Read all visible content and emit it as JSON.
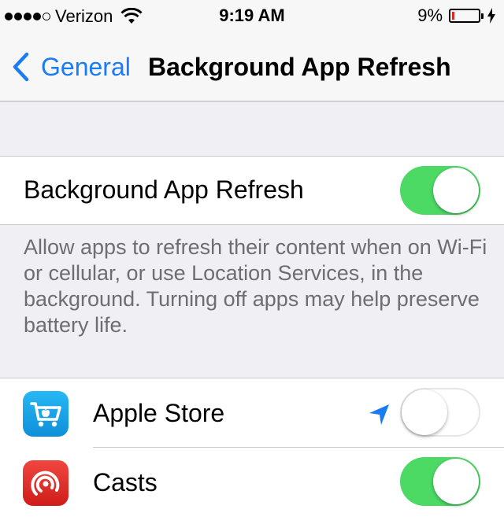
{
  "status_bar": {
    "carrier": "Verizon",
    "time": "9:19 AM",
    "battery_percent": "9%",
    "battery_level": 0.09,
    "signal_bars_filled": 4,
    "signal_bars_total": 5
  },
  "nav": {
    "back_label": "General",
    "title": "Background App Refresh"
  },
  "main_setting": {
    "label": "Background App Refresh",
    "enabled": true
  },
  "description": "Allow apps to refresh their content when on Wi-Fi or cellular, or use Location Services, in the background. Turning off apps may help preserve battery life.",
  "apps": [
    {
      "name": "Apple Store",
      "enabled": false,
      "uses_location": true,
      "icon": "apple-store-app-icon"
    },
    {
      "name": "Casts",
      "enabled": true,
      "uses_location": false,
      "icon": "casts-app-icon"
    }
  ],
  "colors": {
    "accent": "#1a7cf5",
    "toggle_on": "#4cd964",
    "battery_low": "#e0261d",
    "background": "#efeff4",
    "footer_text": "#6d6d72"
  }
}
